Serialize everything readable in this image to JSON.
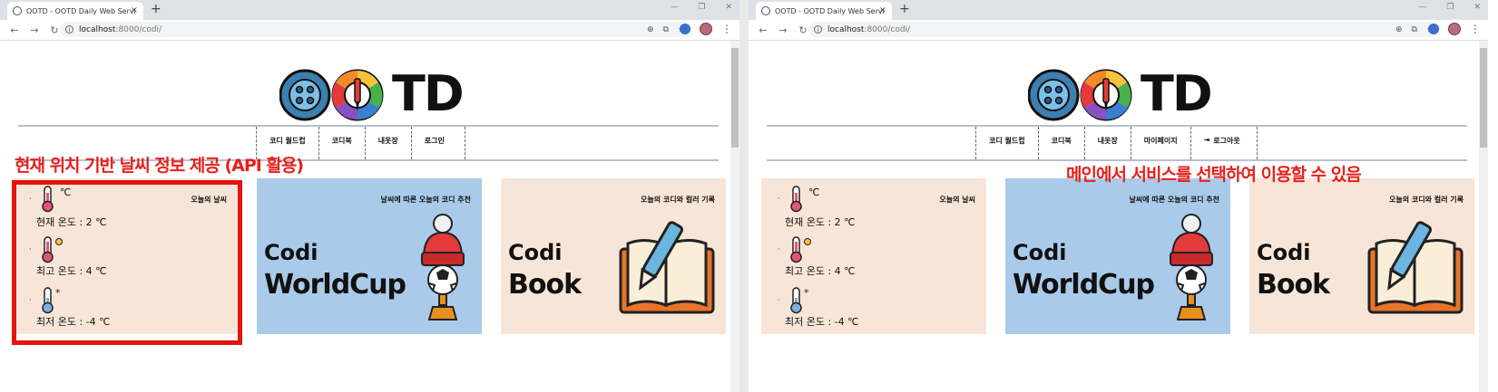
{
  "browser": {
    "tab_title": "OOTD - OOTD Daily Web Servi",
    "url_host": "localhost",
    "url_path": ":8000/codi/",
    "new_tab": "+",
    "tab_close": "×"
  },
  "site": {
    "logo_text": "TD"
  },
  "left": {
    "nav": [
      "코디 월드컵",
      "코디북",
      "내옷장",
      "로그인"
    ]
  },
  "right": {
    "nav": [
      "코디 월드컵",
      "코디북",
      "내옷장",
      "마이페이지",
      "로그아웃"
    ],
    "logout_icon": "sign-out-icon"
  },
  "weather": {
    "title": "오늘의 날씨",
    "current_icon_unit": "℃",
    "current": "현재 온도 : 2 ℃",
    "high": "최고 온도 : 4 ℃",
    "low": "최저 온도 : -4 ℃",
    "bullet": "·"
  },
  "worldcup": {
    "title": "날씨에 따른 오늘의 코디 추천",
    "line1": "Codi",
    "line2": "WorldCup"
  },
  "book": {
    "title": "오늘의 코디와 컬러 기록",
    "line1": "Codi",
    "line2": "Book"
  },
  "annotations": {
    "left": "현재 위치 기반 날씨 정보 제공 (API 활용)",
    "right": "메인에서 서비스를 선택하여 이용할 수 있음"
  },
  "colors": {
    "annotation": "#e8201c",
    "card_beige": "#f7e6d7",
    "card_blue": "#a9cbe9",
    "nav_border": "#b8bfd2"
  }
}
